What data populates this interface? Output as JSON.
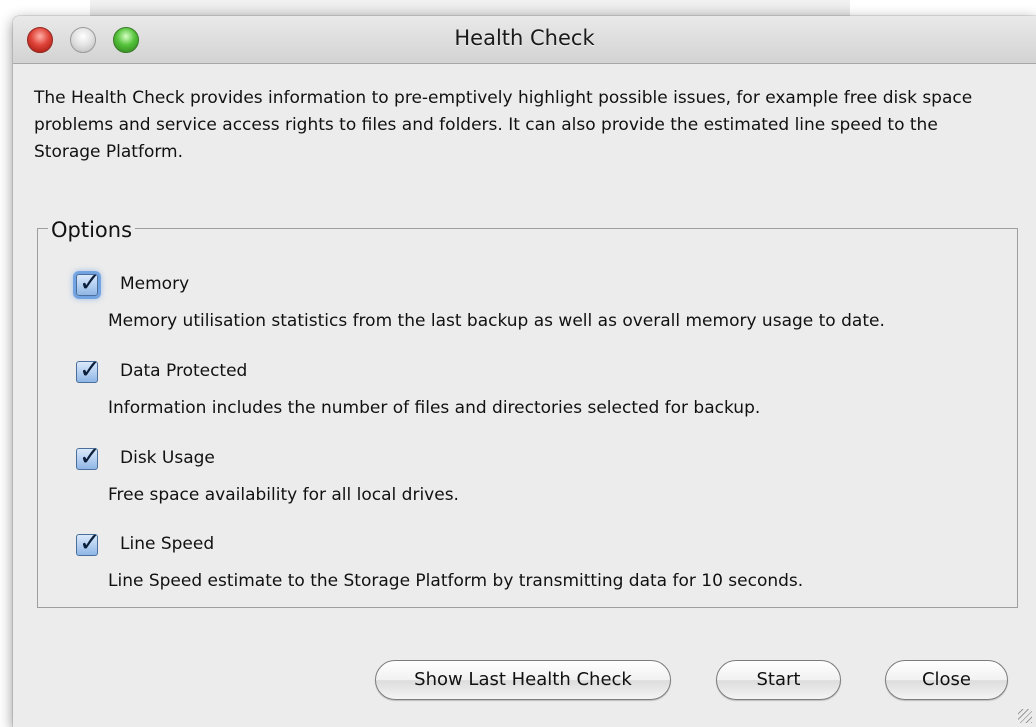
{
  "window": {
    "title": "Health Check"
  },
  "intro_text": "The Health Check provides information to pre-emptively highlight possible issues, for example free disk space problems and service access rights to files and folders. It can also provide the estimated line speed to the Storage Platform.",
  "options": {
    "legend": "Options",
    "items": [
      {
        "label": "Memory",
        "checked": true,
        "description": "Memory utilisation statistics from the last backup as well as overall memory usage to date."
      },
      {
        "label": "Data Protected",
        "checked": true,
        "description": "Information includes the number of files and directories selected for backup."
      },
      {
        "label": "Disk Usage",
        "checked": true,
        "description": "Free space availability for all local drives."
      },
      {
        "label": "Line Speed",
        "checked": true,
        "description": "Line Speed estimate to the Storage Platform by transmitting data for 10 seconds."
      }
    ]
  },
  "buttons": {
    "show_last": "Show Last Health Check",
    "start": "Start",
    "close": "Close"
  },
  "checkmark_glyph": "✓",
  "colors": {
    "checkbox_accent": "#5c95e0",
    "window_bg": "#ececec"
  }
}
